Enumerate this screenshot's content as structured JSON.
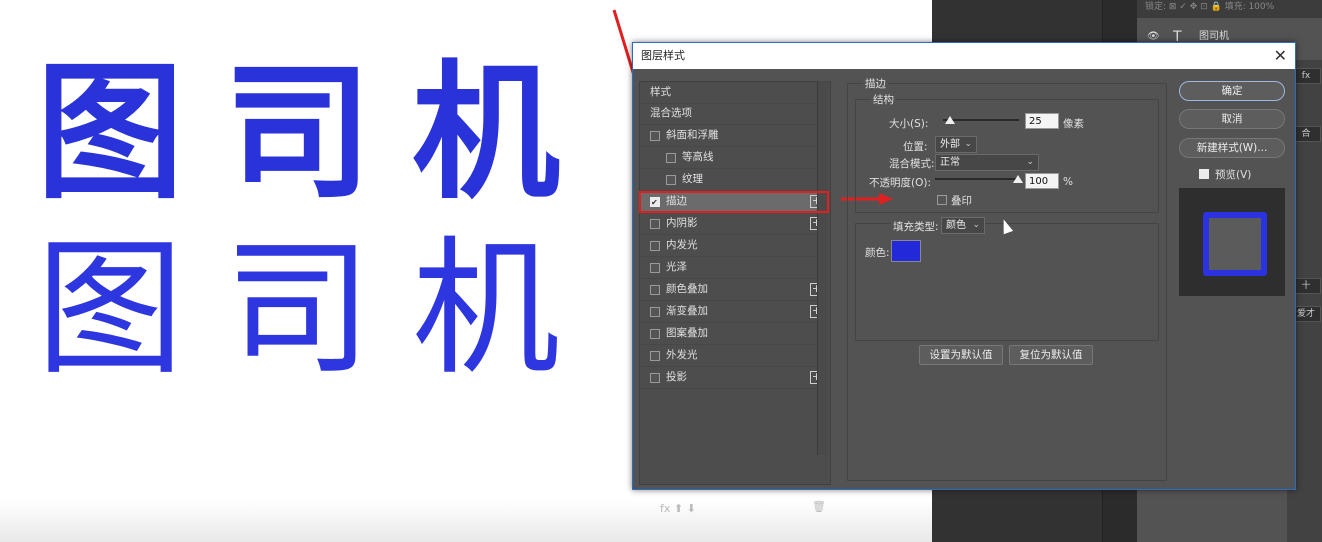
{
  "canvas": {
    "bold_text": "图司机",
    "thin_text": "图司机",
    "text_color": "#2a33d9"
  },
  "ps_panel": {
    "topbar": "锁定: ⊠ ✓ ✥ ⊡ 🔒 填充: 100%",
    "layer_name": "图司机",
    "layer_icon": "T",
    "right_labels": [
      "fx",
      "合",
      "十",
      "爱才"
    ]
  },
  "dialog": {
    "title": "图层样式",
    "close": "✕",
    "list_header": "样式",
    "items": [
      {
        "label": "混合选项",
        "checkbox": false,
        "plus": false,
        "indent": 0,
        "checked": false
      },
      {
        "label": "斜面和浮雕",
        "checkbox": true,
        "plus": false,
        "indent": 0,
        "checked": false
      },
      {
        "label": "等高线",
        "checkbox": true,
        "plus": false,
        "indent": 1,
        "checked": false
      },
      {
        "label": "纹理",
        "checkbox": true,
        "plus": false,
        "indent": 1,
        "checked": false
      },
      {
        "label": "描边",
        "checkbox": true,
        "plus": true,
        "indent": 0,
        "checked": true
      },
      {
        "label": "内阴影",
        "checkbox": true,
        "plus": true,
        "indent": 0,
        "checked": false
      },
      {
        "label": "内发光",
        "checkbox": true,
        "plus": false,
        "indent": 0,
        "checked": false
      },
      {
        "label": "光泽",
        "checkbox": true,
        "plus": false,
        "indent": 0,
        "checked": false
      },
      {
        "label": "颜色叠加",
        "checkbox": true,
        "plus": true,
        "indent": 0,
        "checked": false
      },
      {
        "label": "渐变叠加",
        "checkbox": true,
        "plus": true,
        "indent": 0,
        "checked": false
      },
      {
        "label": "图案叠加",
        "checkbox": true,
        "plus": false,
        "indent": 0,
        "checked": false
      },
      {
        "label": "外发光",
        "checkbox": true,
        "plus": false,
        "indent": 0,
        "checked": false
      },
      {
        "label": "投影",
        "checkbox": true,
        "plus": true,
        "indent": 0,
        "checked": false
      }
    ],
    "bottom_tools": "fx  ⬆  ⬇",
    "trash_icon": "🗑",
    "stroke": {
      "section_title": "描边",
      "structure_title": "结构",
      "size_label": "大小(S):",
      "size_value": "25",
      "size_unit": "像素",
      "position_label": "位置:",
      "position_value": "外部",
      "blend_label": "混合模式:",
      "blend_value": "正常",
      "opacity_label": "不透明度(O):",
      "opacity_value": "100",
      "opacity_unit": "%",
      "overprint_label": "叠印",
      "fill_type_label": "填充类型:",
      "fill_type_value": "颜色",
      "color_label": "颜色:",
      "color_value": "#2329d9"
    },
    "buttons": {
      "set_default": "设置为默认值",
      "reset_default": "复位为默认值",
      "ok": "确定",
      "cancel": "取消",
      "new_style": "新建样式(W)...",
      "preview_label": "预览(V)"
    }
  }
}
